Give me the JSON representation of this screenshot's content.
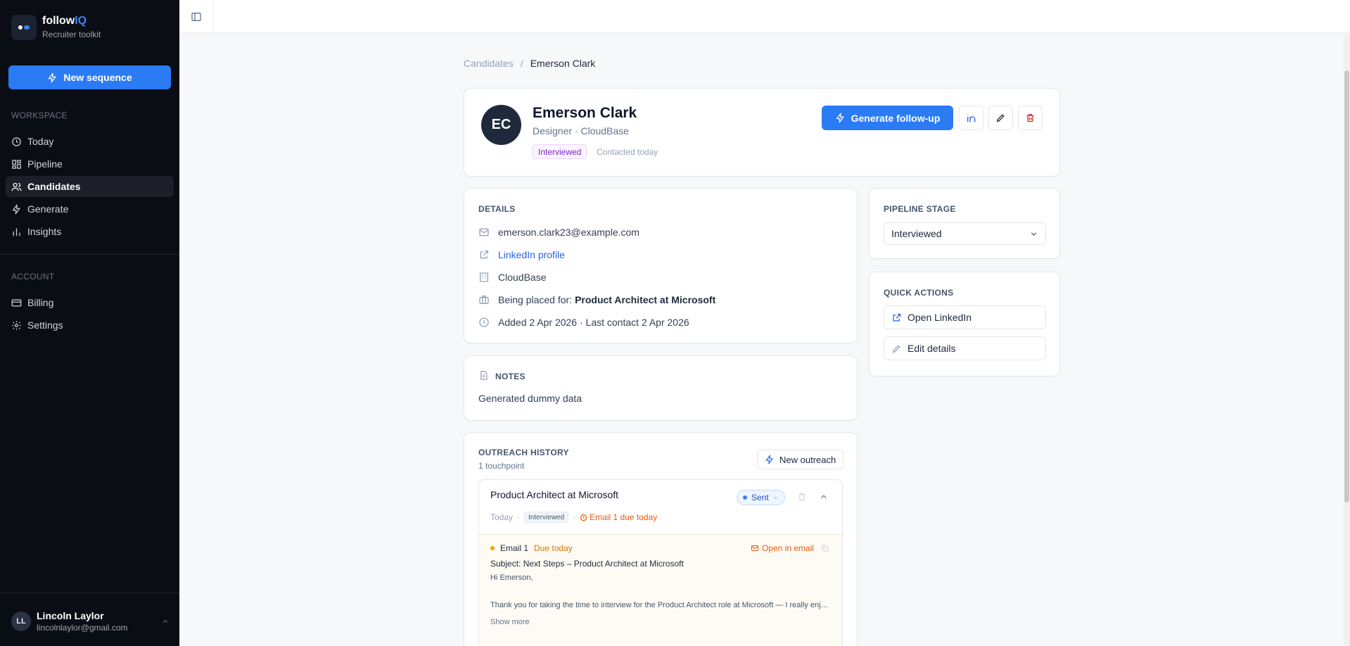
{
  "brand": {
    "name_prefix": "follow",
    "name_suffix": "IQ",
    "subtitle": "Recruiter toolkit"
  },
  "sidebar": {
    "new_sequence_label": "New sequence",
    "workspace_label": "WORKSPACE",
    "workspace_items": [
      {
        "label": "Today",
        "icon": "clock-icon"
      },
      {
        "label": "Pipeline",
        "icon": "grid-icon"
      },
      {
        "label": "Candidates",
        "icon": "users-icon",
        "active": true
      },
      {
        "label": "Generate",
        "icon": "bolt-icon"
      },
      {
        "label": "Insights",
        "icon": "bar-chart-icon"
      }
    ],
    "account_label": "ACCOUNT",
    "account_items": [
      {
        "label": "Billing",
        "icon": "credit-card-icon"
      },
      {
        "label": "Settings",
        "icon": "gear-icon"
      }
    ],
    "user": {
      "initials": "LL",
      "name": "Lincoln Laylor",
      "email": "lincolnlaylor@gmail.com"
    }
  },
  "breadcrumb": {
    "parent": "Candidates",
    "separator": "/",
    "current": "Emerson Clark"
  },
  "candidate": {
    "initials": "EC",
    "name": "Emerson Clark",
    "role": "Designer · CloudBase",
    "status_tag": "Interviewed",
    "contacted": "Contacted today",
    "generate_label": "Generate follow-up"
  },
  "details": {
    "title": "DETAILS",
    "email": "emerson.clark23@example.com",
    "linkedin": "LinkedIn profile",
    "company": "CloudBase",
    "placed_prefix": "Being placed for:",
    "placed_role": "Product Architect at Microsoft",
    "dates": "Added 2 Apr 2026 · Last contact 2 Apr 2026"
  },
  "notes": {
    "title": "NOTES",
    "text": "Generated dummy data"
  },
  "outreach": {
    "title": "OUTREACH HISTORY",
    "count": "1 touchpoint",
    "new_label": "New outreach",
    "item": {
      "title": "Product Architect at Microsoft",
      "status": "Sent",
      "date": "Today",
      "stage": "Interviewed",
      "due": "Email 1 due today",
      "email": {
        "label": "Email 1",
        "due": "Due today",
        "open_label": "Open in email",
        "subject": "Subject: Next Steps – Product Architect at Microsoft",
        "greeting": "Hi Emerson,",
        "body": "Thank you for taking the time to interview for the Product Architect role at Microsoft — I really enjoyed learning more about your design background and approach.",
        "show_more": "Show more"
      }
    }
  },
  "pipeline": {
    "title": "PIPELINE STAGE",
    "selected": "Interviewed"
  },
  "quick_actions": {
    "title": "QUICK ACTIONS",
    "open_linkedin": "Open LinkedIn",
    "edit_details": "Edit details"
  },
  "colors": {
    "accent": "#2b7bf5",
    "sidebar_bg": "#0a0d14",
    "danger": "#dc2626",
    "warning": "#ea580c"
  }
}
